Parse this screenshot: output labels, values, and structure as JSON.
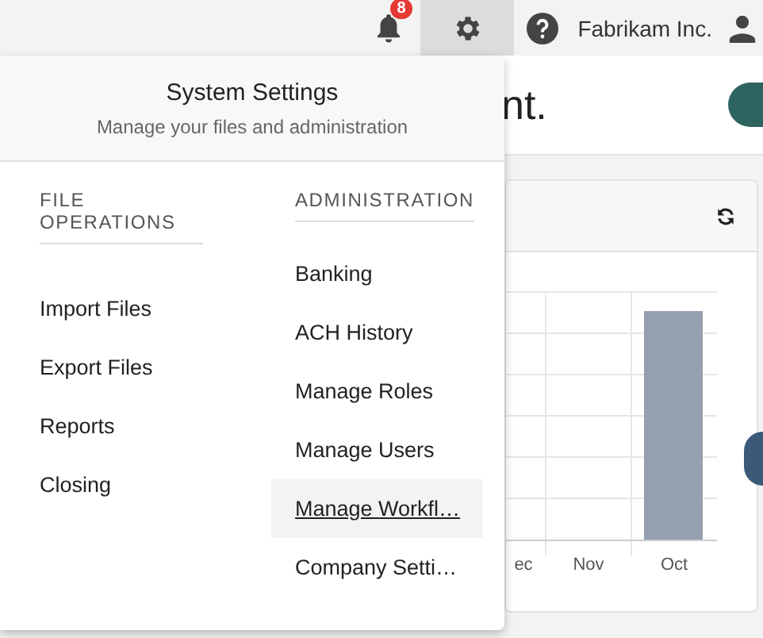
{
  "top_bar": {
    "notifications": {
      "badge": "8"
    },
    "settings": {
      "selected": true
    },
    "company": "Fabrikam Inc."
  },
  "page": {
    "heading": "nt.",
    "chart": {
      "labels": [
        "ec",
        "Nov",
        "Oct"
      ]
    }
  },
  "settings_menu": {
    "title": "System Settings",
    "subtitle": "Manage your files and administration",
    "columns": [
      {
        "heading": "FILE OPERATIONS",
        "items": [
          {
            "label": "Import Files",
            "selected": false
          },
          {
            "label": "Export Files",
            "selected": false
          },
          {
            "label": "Reports",
            "selected": false
          },
          {
            "label": "Closing",
            "selected": false
          }
        ]
      },
      {
        "heading": "ADMINISTRATION",
        "items": [
          {
            "label": "Banking",
            "selected": false
          },
          {
            "label": "ACH History",
            "selected": false
          },
          {
            "label": "Manage Roles",
            "selected": false
          },
          {
            "label": "Manage Users",
            "selected": false
          },
          {
            "label": "Manage Workfl…",
            "selected": true
          },
          {
            "label": "Company Setti…",
            "selected": false
          }
        ]
      }
    ]
  }
}
